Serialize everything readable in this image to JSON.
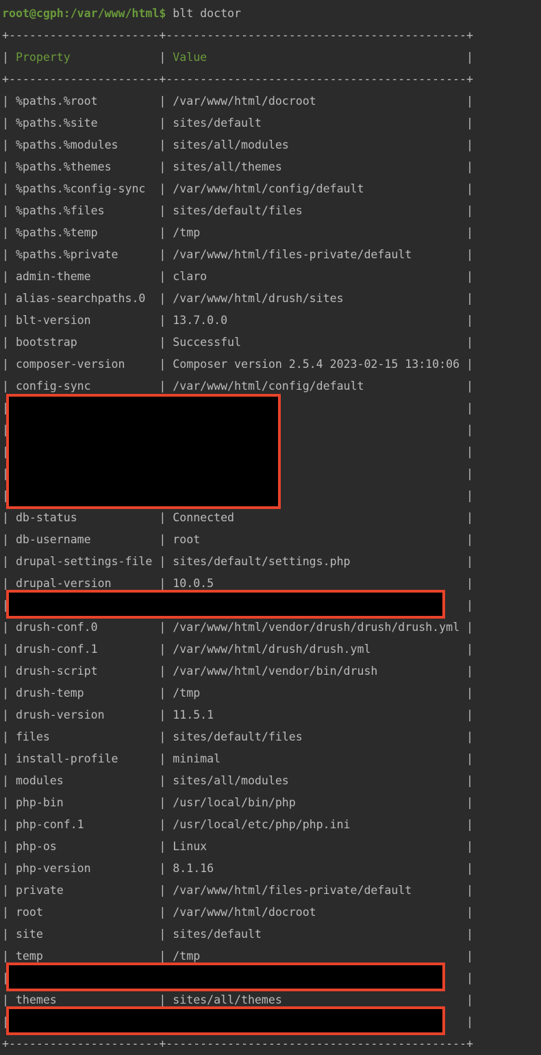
{
  "terminal": {
    "prompt": "root@cgph:/var/www/html$",
    "command": "blt doctor",
    "table": {
      "headers": [
        "Property",
        "Value"
      ],
      "rows": [
        {
          "property": "%paths.%root",
          "value": "/var/www/html/docroot"
        },
        {
          "property": "%paths.%site",
          "value": "sites/default"
        },
        {
          "property": "%paths.%modules",
          "value": "sites/all/modules"
        },
        {
          "property": "%paths.%themes",
          "value": "sites/all/themes"
        },
        {
          "property": "%paths.%config-sync",
          "value": "/var/www/html/config/default"
        },
        {
          "property": "%paths.%files",
          "value": "sites/default/files"
        },
        {
          "property": "%paths.%temp",
          "value": "/tmp"
        },
        {
          "property": "%paths.%private",
          "value": "/var/www/html/files-private/default"
        },
        {
          "property": "admin-theme",
          "value": "claro"
        },
        {
          "property": "alias-searchpaths.0",
          "value": "/var/www/html/drush/sites"
        },
        {
          "property": "blt-version",
          "value": "13.7.0.0"
        },
        {
          "property": "bootstrap",
          "value": "Successful"
        },
        {
          "property": "composer-version",
          "value": "Composer version 2.5.4 2023-02-15 13:10:06"
        },
        {
          "property": "config-sync",
          "value": "/var/www/html/config/default"
        },
        {
          "redacted": true
        },
        {
          "redacted": true
        },
        {
          "redacted": true
        },
        {
          "redacted": true
        },
        {
          "redacted": true
        },
        {
          "property": "db-status",
          "value": "Connected"
        },
        {
          "property": "db-username",
          "value": "root"
        },
        {
          "property": "drupal-settings-file",
          "value": "sites/default/settings.php"
        },
        {
          "property": "drupal-version",
          "value": "10.0.5"
        },
        {
          "redacted": true
        },
        {
          "property": "drush-conf.0",
          "value": "/var/www/html/vendor/drush/drush/drush.yml"
        },
        {
          "property": "drush-conf.1",
          "value": "/var/www/html/drush/drush.yml"
        },
        {
          "property": "drush-script",
          "value": "/var/www/html/vendor/bin/drush"
        },
        {
          "property": "drush-temp",
          "value": "/tmp"
        },
        {
          "property": "drush-version",
          "value": "11.5.1"
        },
        {
          "property": "files",
          "value": "sites/default/files"
        },
        {
          "property": "install-profile",
          "value": "minimal"
        },
        {
          "property": "modules",
          "value": "sites/all/modules"
        },
        {
          "property": "php-bin",
          "value": "/usr/local/bin/php"
        },
        {
          "property": "php-conf.1",
          "value": "/usr/local/etc/php/php.ini"
        },
        {
          "property": "php-os",
          "value": "Linux"
        },
        {
          "property": "php-version",
          "value": "8.1.16"
        },
        {
          "property": "private",
          "value": "/var/www/html/files-private/default"
        },
        {
          "property": "root",
          "value": "/var/www/html/docroot"
        },
        {
          "property": "site",
          "value": "sites/default"
        },
        {
          "property": "temp",
          "value": "/tmp"
        },
        {
          "redacted": true
        },
        {
          "property": "themes",
          "value": "sites/all/themes"
        },
        {
          "redacted": true
        }
      ]
    },
    "colors": {
      "background": "#2b2b2b",
      "text": "#bbbbbb",
      "prompt_green": "#6a9a3b",
      "redaction_border": "#e8432b",
      "redaction_fill": "#000000"
    }
  }
}
